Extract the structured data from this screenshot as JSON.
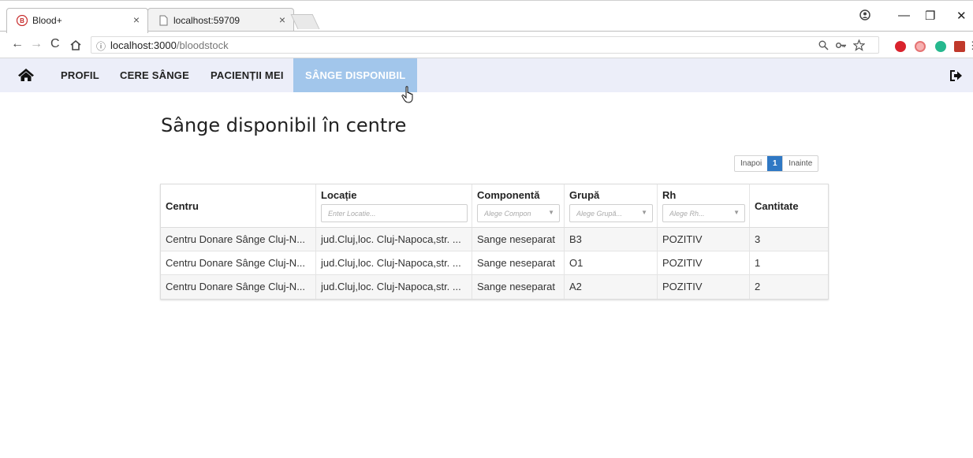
{
  "browser": {
    "tabs": [
      {
        "title": "Blood+",
        "close": "×"
      },
      {
        "title": "localhost:59709",
        "close": "×"
      }
    ],
    "url_host": "localhost:3000",
    "url_path": "/bloodstock",
    "info_icon": "ⓘ",
    "window_controls": {
      "minimize": "—",
      "maximize": "❐",
      "close": "✕"
    }
  },
  "nav": {
    "items": [
      "PROFIL",
      "CERE SÂNGE",
      "PACIENȚII MEI",
      "SÂNGE DISPONIBIL"
    ],
    "active": "SÂNGE DISPONIBIL",
    "active_color": "#a2c6eb"
  },
  "page": {
    "title": "Sânge disponibil în centre"
  },
  "pager": {
    "prev": "Inapoi",
    "current": "1",
    "next": "Inainte"
  },
  "table": {
    "columns": [
      {
        "label": "Centru"
      },
      {
        "label": "Locație",
        "filter_placeholder": "Enter Locatie..."
      },
      {
        "label": "Componentă",
        "filter_placeholder": "Alege Compon"
      },
      {
        "label": "Grupă",
        "filter_placeholder": "Alege Grupă..."
      },
      {
        "label": "Rh",
        "filter_placeholder": "Alege Rh..."
      },
      {
        "label": "Cantitate"
      }
    ],
    "rows": [
      [
        "Centru Donare Sânge Cluj-N...",
        "jud.Cluj,loc. Cluj-Napoca,str. ...",
        "Sange neseparat",
        "B3",
        "POZITIV",
        "3"
      ],
      [
        "Centru Donare Sânge Cluj-N...",
        "jud.Cluj,loc. Cluj-Napoca,str. ...",
        "Sange neseparat",
        "O1",
        "POZITIV",
        "1"
      ],
      [
        "Centru Donare Sânge Cluj-N...",
        "jud.Cluj,loc. Cluj-Napoca,str. ...",
        "Sange neseparat",
        "A2",
        "POZITIV",
        "2"
      ]
    ]
  },
  "colors": {
    "navbar_bg": "#eceef9",
    "pager_active": "#2f78c4"
  }
}
